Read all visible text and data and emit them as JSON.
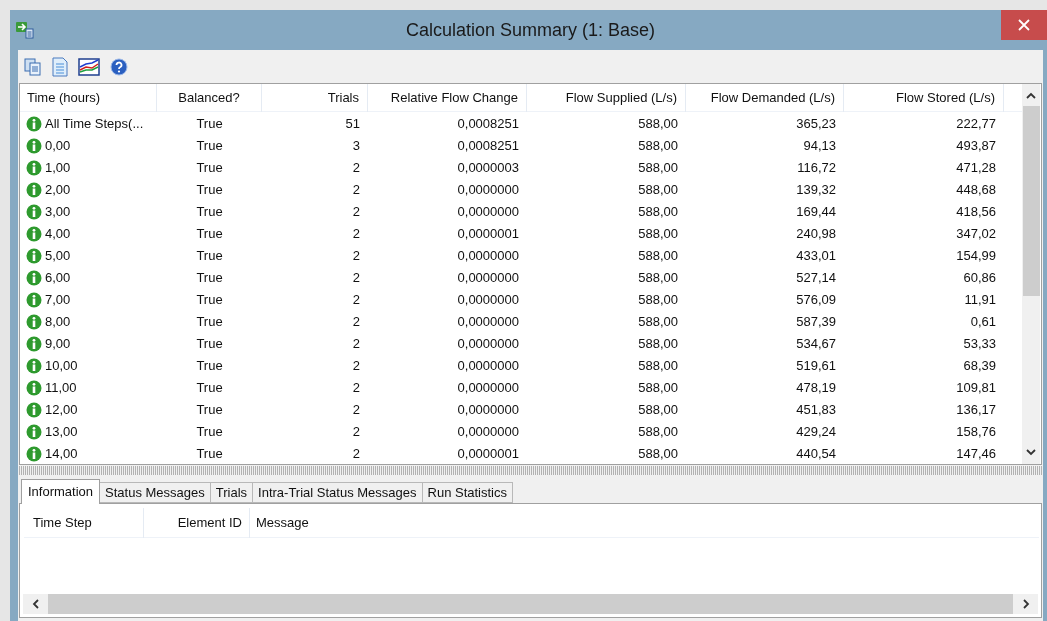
{
  "window": {
    "title": "Calculation Summary (1: Base)"
  },
  "table": {
    "columns": [
      "Time (hours)",
      "Balanced?",
      "Trials",
      "Relative Flow Change",
      "Flow Supplied (L/s)",
      "Flow Demanded (L/s)",
      "Flow Stored (L/s)"
    ],
    "rows": [
      [
        "All Time Steps(...",
        "True",
        "51",
        "0,0008251",
        "588,00",
        "365,23",
        "222,77"
      ],
      [
        "0,00",
        "True",
        "3",
        "0,0008251",
        "588,00",
        "94,13",
        "493,87"
      ],
      [
        "1,00",
        "True",
        "2",
        "0,0000003",
        "588,00",
        "116,72",
        "471,28"
      ],
      [
        "2,00",
        "True",
        "2",
        "0,0000000",
        "588,00",
        "139,32",
        "448,68"
      ],
      [
        "3,00",
        "True",
        "2",
        "0,0000000",
        "588,00",
        "169,44",
        "418,56"
      ],
      [
        "4,00",
        "True",
        "2",
        "0,0000001",
        "588,00",
        "240,98",
        "347,02"
      ],
      [
        "5,00",
        "True",
        "2",
        "0,0000000",
        "588,00",
        "433,01",
        "154,99"
      ],
      [
        "6,00",
        "True",
        "2",
        "0,0000000",
        "588,00",
        "527,14",
        "60,86"
      ],
      [
        "7,00",
        "True",
        "2",
        "0,0000000",
        "588,00",
        "576,09",
        "11,91"
      ],
      [
        "8,00",
        "True",
        "2",
        "0,0000000",
        "588,00",
        "587,39",
        "0,61"
      ],
      [
        "9,00",
        "True",
        "2",
        "0,0000000",
        "588,00",
        "534,67",
        "53,33"
      ],
      [
        "10,00",
        "True",
        "2",
        "0,0000000",
        "588,00",
        "519,61",
        "68,39"
      ],
      [
        "11,00",
        "True",
        "2",
        "0,0000000",
        "588,00",
        "478,19",
        "109,81"
      ],
      [
        "12,00",
        "True",
        "2",
        "0,0000000",
        "588,00",
        "451,83",
        "136,17"
      ],
      [
        "13,00",
        "True",
        "2",
        "0,0000000",
        "588,00",
        "429,24",
        "158,76"
      ],
      [
        "14,00",
        "True",
        "2",
        "0,0000001",
        "588,00",
        "440,54",
        "147,46"
      ]
    ]
  },
  "tabs": [
    {
      "label": "Information",
      "selected": true
    },
    {
      "label": "Status Messages",
      "selected": false
    },
    {
      "label": "Trials",
      "selected": false
    },
    {
      "label": "Intra-Trial Status Messages",
      "selected": false
    },
    {
      "label": "Run Statistics",
      "selected": false
    }
  ],
  "messages": {
    "columns": [
      "Time Step",
      "Element ID",
      "Message"
    ]
  }
}
